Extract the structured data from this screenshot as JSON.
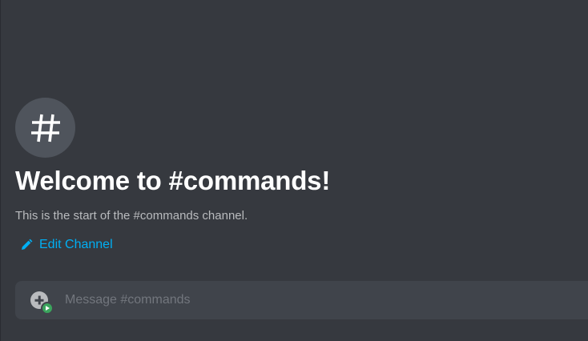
{
  "channel": {
    "icon": "hashtag-icon",
    "welcome_title": "Welcome to #commands!",
    "welcome_subtitle": "This is the start of the #commands channel.",
    "edit_label": "Edit Channel"
  },
  "composer": {
    "placeholder": "Message #commands",
    "value": "",
    "attach_icon": "plus-circle-icon"
  },
  "colors": {
    "background": "#36393f",
    "composer_bg": "#40444b",
    "icon_circle": "#4f545c",
    "link": "#00aff4",
    "muted_text": "#b9bbbe",
    "placeholder": "#72767d",
    "nitro_green": "#3ba55d"
  }
}
